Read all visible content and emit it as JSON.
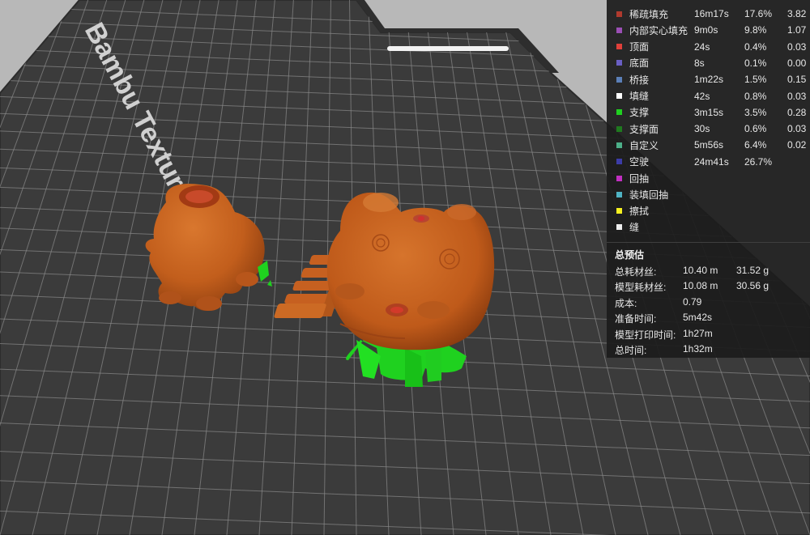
{
  "plate": {
    "brand_text": "Bambu Texture",
    "colors": {
      "background": "#b8b8b8",
      "plate": "#3c3c3c",
      "grid": "#8a8a8a",
      "model": "#c8621c",
      "support": "#1fd11f"
    }
  },
  "legend": {
    "features": [
      {
        "name": "稀疏填充",
        "time": "16m17s",
        "percent": "17.6%",
        "usage": "3.82",
        "color": "#b03a2e"
      },
      {
        "name": "内部实心填充",
        "time": "9m0s",
        "percent": "9.8%",
        "usage": "1.07",
        "color": "#9b4fb5"
      },
      {
        "name": "顶面",
        "time": "24s",
        "percent": "0.4%",
        "usage": "0.03",
        "color": "#e0403a"
      },
      {
        "name": "底面",
        "time": "8s",
        "percent": "0.1%",
        "usage": "0.00",
        "color": "#6a5fc4"
      },
      {
        "name": "桥接",
        "time": "1m22s",
        "percent": "1.5%",
        "usage": "0.15",
        "color": "#5b7fb8"
      },
      {
        "name": "填缝",
        "time": "42s",
        "percent": "0.8%",
        "usage": "0.03",
        "color": "#ffffff"
      },
      {
        "name": "支撑",
        "time": "3m15s",
        "percent": "3.5%",
        "usage": "0.28",
        "color": "#20d020"
      },
      {
        "name": "支撑面",
        "time": "30s",
        "percent": "0.6%",
        "usage": "0.03",
        "color": "#1f7a1f"
      },
      {
        "name": "自定义",
        "time": "5m56s",
        "percent": "6.4%",
        "usage": "0.02",
        "color": "#4caf88"
      },
      {
        "name": "空驶",
        "time": "24m41s",
        "percent": "26.7%",
        "usage": "",
        "color": "#3c3ca8"
      },
      {
        "name": "回抽",
        "time": "",
        "percent": "",
        "usage": "",
        "color": "#c22fc2"
      },
      {
        "name": "装填回抽",
        "time": "",
        "percent": "",
        "usage": "",
        "color": "#4fb3c4"
      },
      {
        "name": "擦拭",
        "time": "",
        "percent": "",
        "usage": "",
        "color": "#f5f020"
      },
      {
        "name": "缝",
        "time": "",
        "percent": "",
        "usage": "",
        "color": "#eeeeee"
      }
    ]
  },
  "summary": {
    "title": "总预估",
    "rows": [
      {
        "label": "总耗材丝:",
        "v1": "10.40 m",
        "v2": "31.52 g"
      },
      {
        "label": "模型耗材丝:",
        "v1": "10.08 m",
        "v2": "30.56 g"
      },
      {
        "label": "成本:",
        "v1": "0.79",
        "v2": ""
      },
      {
        "label": "准备时间:",
        "v1": "5m42s",
        "v2": ""
      },
      {
        "label": "模型打印时间:",
        "v1": "1h27m",
        "v2": ""
      },
      {
        "label": "总时间:",
        "v1": "1h32m",
        "v2": ""
      }
    ]
  }
}
